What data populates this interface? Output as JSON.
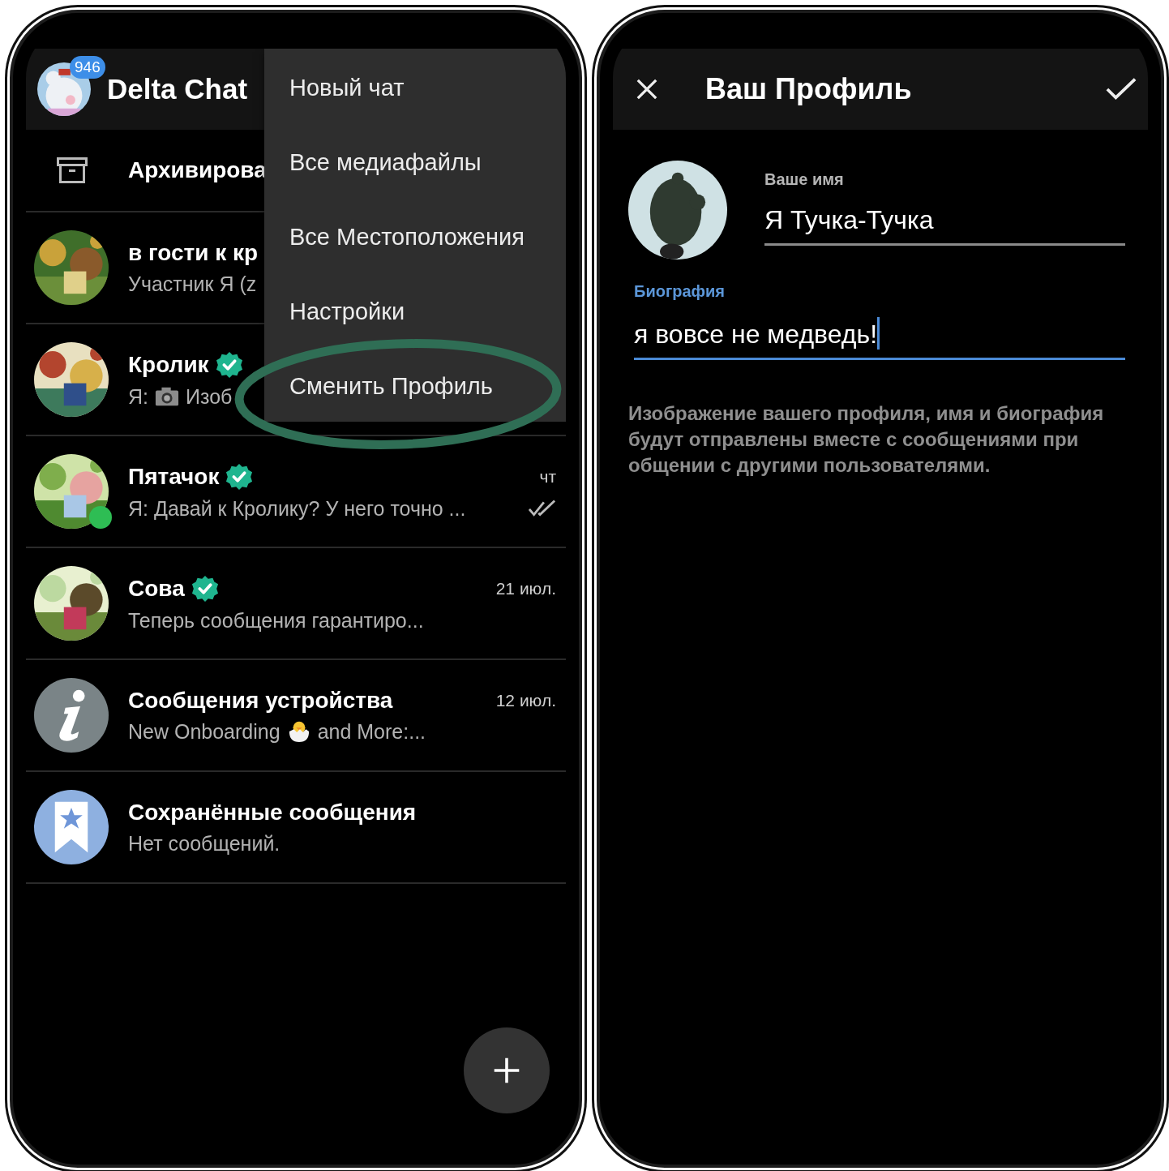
{
  "left": {
    "app_title": "Delta Chat",
    "unread_badge": "946",
    "archive": {
      "label": "Архивирова"
    },
    "chats": [
      {
        "kind": "contact",
        "name": "в гости к кр",
        "preview_parts": [
          {
            "kind": "text",
            "text": "Участник Я (z"
          }
        ],
        "verified": false,
        "online": false,
        "delivered": false
      },
      {
        "kind": "contact",
        "name": "Кролик",
        "preview_parts": [
          {
            "kind": "text",
            "text": "Я:"
          },
          {
            "kind": "camera"
          },
          {
            "kind": "text",
            "text": "Изоб"
          }
        ],
        "verified": true,
        "online": false,
        "delivered": false
      },
      {
        "kind": "contact",
        "name": "Пятачок",
        "preview_parts": [
          {
            "kind": "text",
            "text": "Я: Давай к Кролику? У него точно ..."
          }
        ],
        "time": "чт",
        "verified": true,
        "online": true,
        "delivered": true
      },
      {
        "kind": "contact",
        "name": "Сова",
        "preview_parts": [
          {
            "kind": "text",
            "text": "Теперь сообщения гарантиро..."
          }
        ],
        "time": "21 июл.",
        "verified": true,
        "online": false,
        "delivered": false
      },
      {
        "kind": "device",
        "name": "Сообщения устройства",
        "preview_parts": [
          {
            "kind": "text",
            "text": "New Onboarding"
          },
          {
            "kind": "chick"
          },
          {
            "kind": "text",
            "text": "and More:..."
          }
        ],
        "time": "12 июл.",
        "verified": false,
        "online": false,
        "delivered": false
      },
      {
        "kind": "saved",
        "name": "Сохранённые сообщения",
        "preview_parts": [
          {
            "kind": "text",
            "text": "Нет сообщений."
          }
        ],
        "verified": false,
        "online": false,
        "delivered": false
      }
    ],
    "menu": {
      "items": [
        {
          "label": "Новый чат",
          "highlighted": false
        },
        {
          "label": "Все медиафайлы",
          "highlighted": false
        },
        {
          "label": "Все Местоположения",
          "highlighted": false
        },
        {
          "label": "Настройки",
          "highlighted": false
        },
        {
          "label": "Сменить Профиль",
          "highlighted": true
        }
      ]
    }
  },
  "right": {
    "title": "Ваш Профиль",
    "name_field": {
      "label": "Ваше имя",
      "value": "Я Тучка-Тучка",
      "focused": false
    },
    "bio_field": {
      "label": "Биография",
      "value": "я вовсе не медведь!",
      "focused": true
    },
    "help": "Изображение вашего профиля, имя и биография будут отправлены вместе с сообщениями при общении с другими пользователями."
  }
}
